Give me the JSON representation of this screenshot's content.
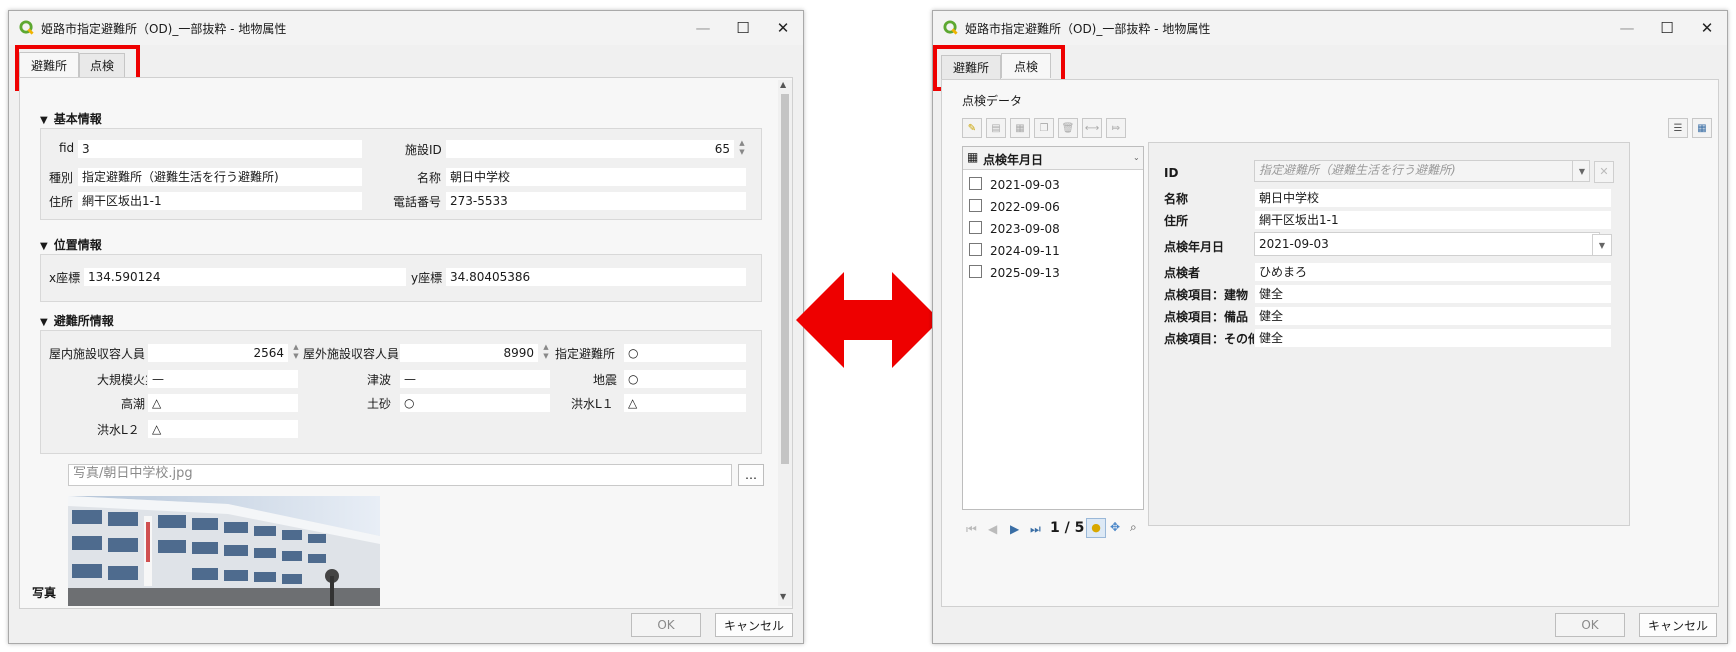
{
  "left_window": {
    "title": "姫路市指定避難所（OD)_一部抜粋 - 地物属性",
    "tabs": [
      "避難所",
      "点検"
    ],
    "sections": {
      "basic": "基本情報",
      "position": "位置情報",
      "shelter": "避難所情報"
    },
    "basic": {
      "fid_label": "fid",
      "fid_value": "3",
      "facility_id_label": "施設ID",
      "facility_id_value": "65",
      "type_label": "種別",
      "type_value": "指定避難所（避難生活を行う避難所)",
      "name_label": "名称",
      "name_value": "朝日中学校",
      "address_label": "住所",
      "address_value": "網干区坂出1-1",
      "phone_label": "電話番号",
      "phone_value": "273-5533"
    },
    "position": {
      "x_label": "x座標",
      "x_value": "134.590124",
      "y_label": "y座標",
      "y_value": "34.80405386"
    },
    "shelter": {
      "indoor_label": "屋内施設収容人員",
      "indoor_value": "2564",
      "outdoor_label": "屋外施設収容人員",
      "outdoor_value": "8990",
      "designated_label": "指定避難所",
      "designated_value": "○",
      "fire_label": "大規模火災",
      "fire_value": "—",
      "tsunami_label": "津波",
      "tsunami_value": "—",
      "quake_label": "地震",
      "quake_value": "○",
      "tide_label": "高潮",
      "tide_value": "△",
      "landslide_label": "土砂",
      "landslide_value": "○",
      "flood1_label": "洪水L１",
      "flood1_value": "△",
      "flood2_label": "洪水L２",
      "flood2_value": "△"
    },
    "photo": {
      "path_placeholder": "写真/朝日中学校.jpg",
      "browse": "…",
      "label": "写真"
    },
    "ok": "OK",
    "cancel": "キャンセル"
  },
  "right_window": {
    "title": "姫路市指定避難所（OD)_一部抜粋 - 地物属性",
    "tabs": [
      "避難所",
      "点検"
    ],
    "section": "点検データ",
    "list_header": "点検年月日",
    "dates": [
      "2021-09-03",
      "2022-09-06",
      "2023-09-08",
      "2024-09-11",
      "2025-09-13"
    ],
    "pager": "1 / 5",
    "form": {
      "id_label": "ID",
      "id_value": "指定避難所（避難生活を行う避難所)",
      "name_label": "名称",
      "name_value": "朝日中学校",
      "address_label": "住所",
      "address_value": "網干区坂出1-1",
      "date_label": "点検年月日",
      "date_value": "2021-09-03",
      "inspector_label": "点検者",
      "inspector_value": "ひめまろ",
      "building_label": "点検項目：建物",
      "building_value": "健全",
      "equipment_label": "点検項目：備品",
      "equipment_value": "健全",
      "other_label": "点検項目：その他",
      "other_value": "健全"
    },
    "ok": "OK",
    "cancel": "キャンセル"
  },
  "colors": {
    "highlight": "#ee0000",
    "arrow": "#ee0000",
    "qgis_green": "#5da831"
  }
}
